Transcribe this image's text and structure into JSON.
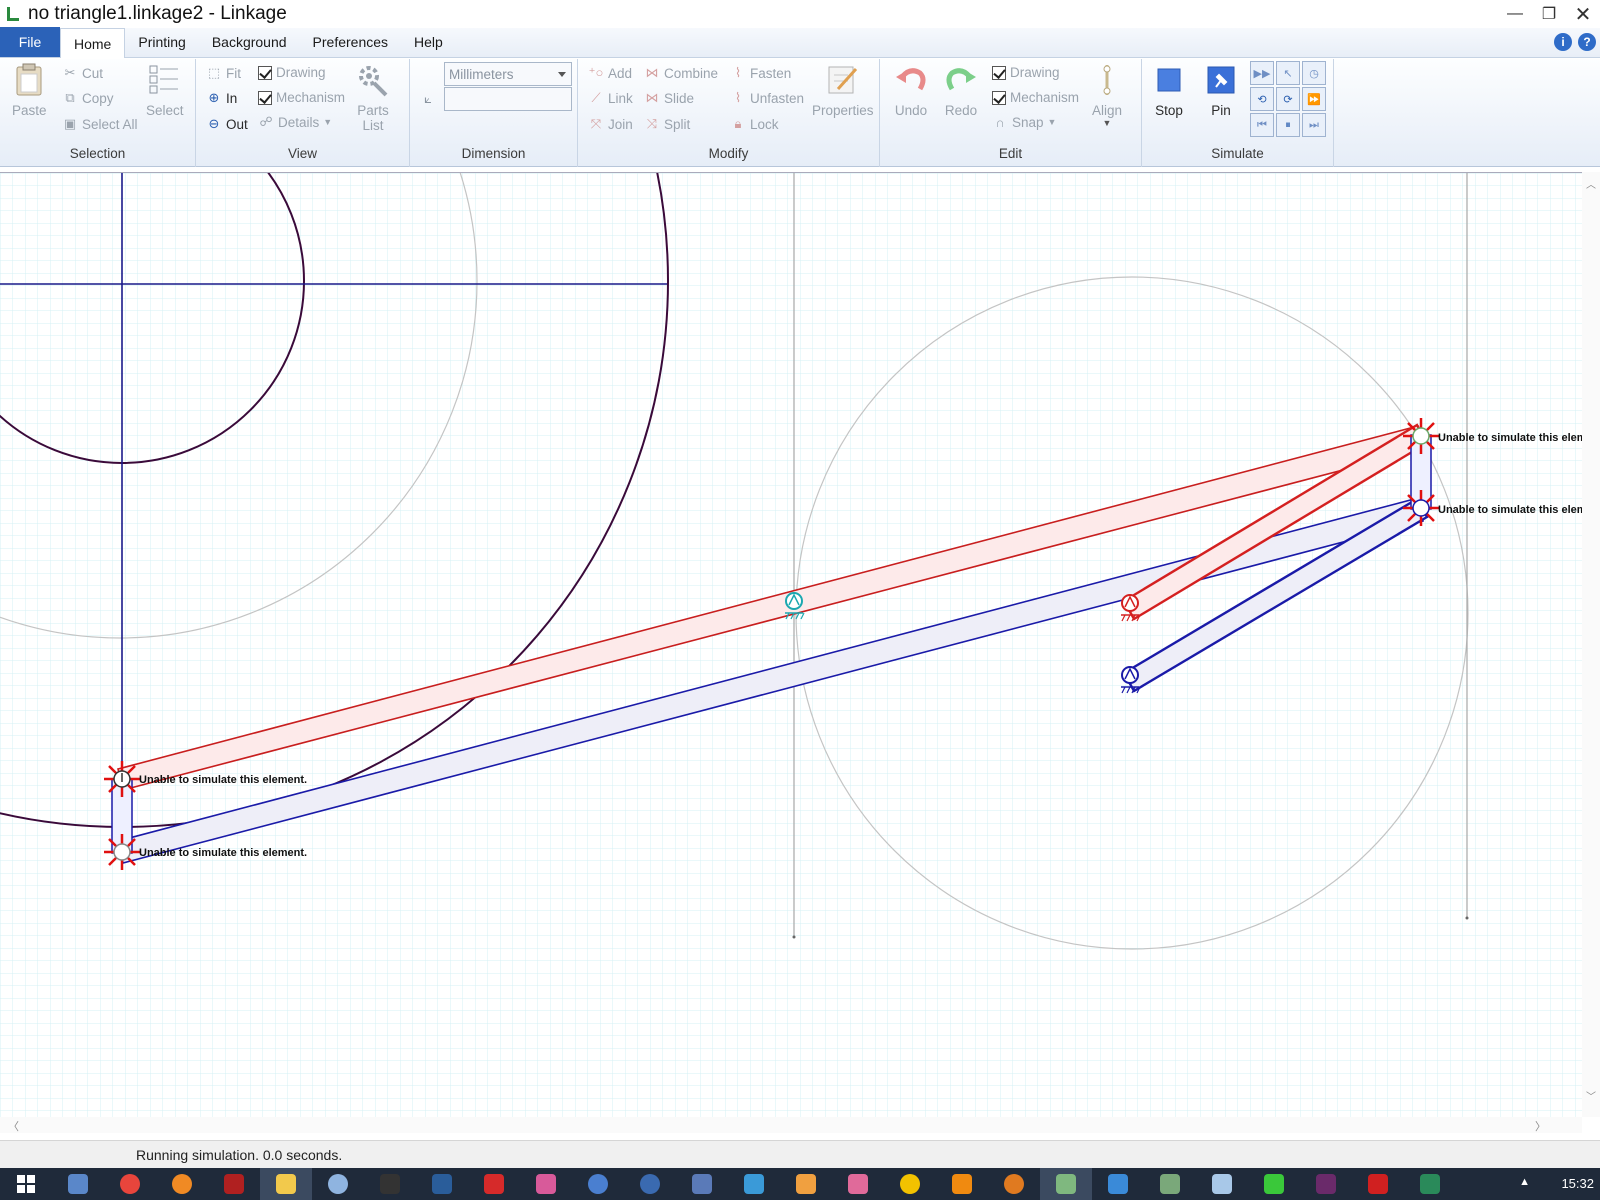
{
  "window": {
    "title": "no triangle1.linkage2 - Linkage",
    "minimize_glyph": "—",
    "maximize_glyph": "❐",
    "close_glyph": "✕"
  },
  "menu": {
    "file": "File",
    "tabs": [
      "Home",
      "Printing",
      "Background",
      "Preferences",
      "Help"
    ],
    "active_tab": "Home",
    "help_icons": [
      "i",
      "?"
    ]
  },
  "ribbon": {
    "selection": {
      "label": "Selection",
      "paste": "Paste",
      "cut": "Cut",
      "copy": "Copy",
      "select_all": "Select All",
      "select": "Select"
    },
    "view": {
      "label": "View",
      "fit": "Fit",
      "zoom_in": "In",
      "zoom_out": "Out",
      "drawing": "Drawing",
      "mechanism": "Mechanism",
      "details": "Details",
      "parts_list_line1": "Parts",
      "parts_list_line2": "List"
    },
    "dimension": {
      "label": "Dimension",
      "units_value": "Millimeters",
      "input_value": ""
    },
    "modify": {
      "label": "Modify",
      "add": "Add",
      "combine": "Combine",
      "fasten": "Fasten",
      "link": "Link",
      "slide": "Slide",
      "unfasten": "Unfasten",
      "join": "Join",
      "split": "Split",
      "lock": "Lock",
      "properties": "Properties"
    },
    "edit": {
      "label": "Edit",
      "undo": "Undo",
      "redo": "Redo",
      "drawing": "Drawing",
      "mechanism": "Mechanism",
      "snap": "Snap",
      "align": "Align"
    },
    "simulate": {
      "label": "Simulate",
      "stop": "Stop",
      "pin": "Pin"
    }
  },
  "canvas": {
    "warnings": [
      "Unable to simulate this element.",
      "Unable to simulate this element.",
      "Unable to simulate this elem",
      "Unable to simulate this elem"
    ],
    "colors": {
      "red_link": "#d42020",
      "blue_link": "#1a1aa8",
      "grid": "#cfeef2",
      "circle_dark": "#3a0a3a",
      "anchor_cyan": "#1ba8b0"
    }
  },
  "status": {
    "text": "Running simulation. 0.0 seconds."
  },
  "taskbar": {
    "clock": "15:32"
  }
}
